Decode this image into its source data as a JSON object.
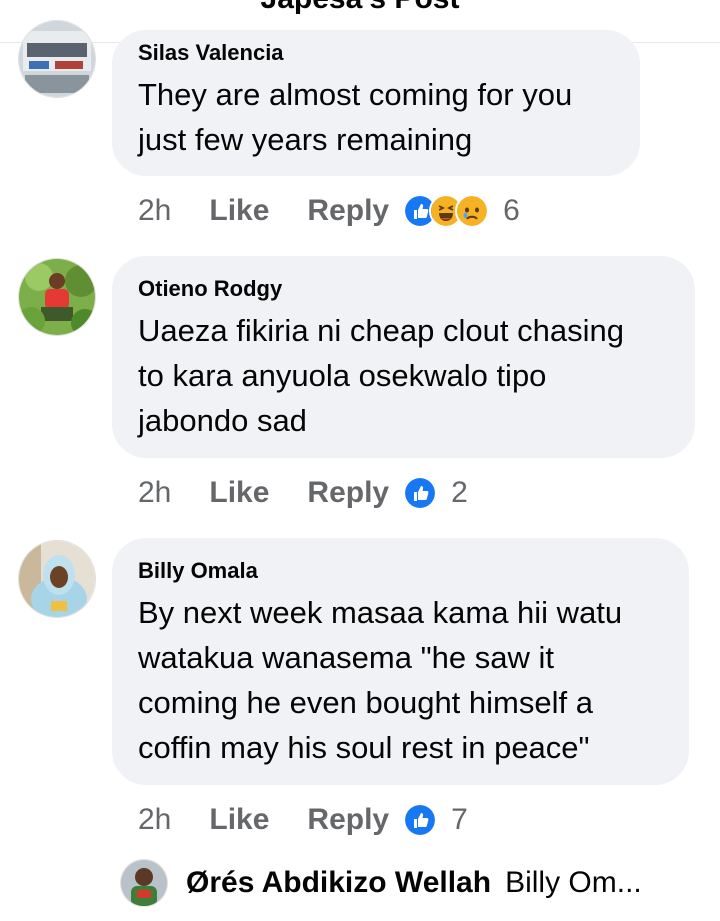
{
  "header": {
    "title": "Japesa's Post"
  },
  "comments": [
    {
      "author": "Silas Valencia",
      "text": "They are almost coming for you\njust few years remaining",
      "time": "2h",
      "like_label": "Like",
      "reply_label": "Reply",
      "reactions": [
        "like-reaction-icon",
        "haha-reaction-icon",
        "sad-reaction-icon"
      ],
      "reaction_count": "6"
    },
    {
      "author": "Otieno Rodgy",
      "text": "Uaeza fikiria ni cheap clout chasing\nto kara anyuola osekwalo tipo\njabondo sad",
      "time": "2h",
      "like_label": "Like",
      "reply_label": "Reply",
      "reactions": [
        "like-reaction-icon"
      ],
      "reaction_count": "2"
    },
    {
      "author": "Billy Omala",
      "text": "By next week masaa kama hii watu\nwatakua wanasema \"he saw it\ncoming he even bought himself a\ncoffin may his soul rest in peace\"",
      "time": "2h",
      "like_label": "Like",
      "reply_label": "Reply",
      "reactions": [
        "like-reaction-icon"
      ],
      "reaction_count": "7"
    }
  ],
  "reply_preview": {
    "author": "Ørés Abdikizo Wellah",
    "text": "Billy Om..."
  },
  "colors": {
    "bubble": "#f0f2f5",
    "meta_text": "#65676b",
    "like_blue": "#1877f2",
    "emoji_yellow": "#f7b125"
  }
}
